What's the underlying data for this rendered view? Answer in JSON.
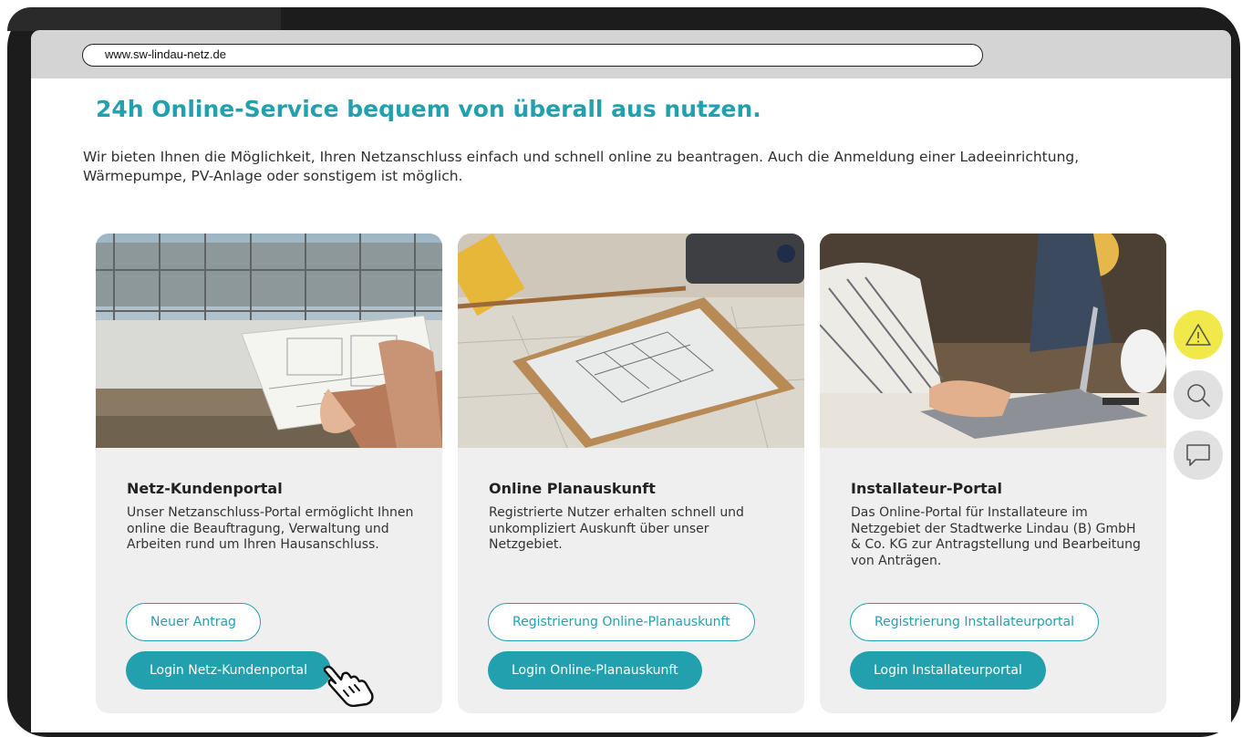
{
  "browser": {
    "url": "www.sw-lindau-netz.de"
  },
  "page": {
    "title": "24h Online-Service bequem von überall aus nutzen.",
    "intro": "Wir bieten Ihnen die Möglichkeit, Ihren Netzanschluss einfach und schnell online zu beantragen. Auch die Anmeldung einer Ladeeinrichtung, Wärmepumpe, PV-Anlage oder sonstigem ist möglich."
  },
  "cards": [
    {
      "title": "Netz-Kundenportal",
      "description": "Unser Netzanschluss-Portal ermöglicht Ihnen online die Beauftragung, Verwaltung und Arbeiten rund um Ihren Hausanschluss.",
      "secondary_button": "Neuer Antrag",
      "primary_button": "Login Netz-Kundenportal"
    },
    {
      "title": "Online Planauskunft",
      "description": "Registrierte Nutzer erhalten schnell und unkompliziert Auskunft über unser Netzgebiet.",
      "secondary_button": "Registrierung Online-Planauskunft",
      "primary_button": "Login Online-Planauskunft"
    },
    {
      "title": "Installateur-Portal",
      "description": "Das Online-Portal für Installateure im Netzgebiet der Stadtwerke Lindau (B) GmbH & Co. KG zur Antragstellung und Bearbeitung von Anträgen.",
      "secondary_button": "Registrierung Installateurportal",
      "primary_button": "Login Installateurportal"
    }
  ],
  "side_actions": [
    {
      "icon": "warning-icon",
      "color": "#f1e94a"
    },
    {
      "icon": "search-icon",
      "color": "#e1e1e1"
    },
    {
      "icon": "chat-icon",
      "color": "#e1e1e1"
    }
  ],
  "colors": {
    "accent": "#23a0ae",
    "card_bg": "#efefef",
    "device_frame": "#1c1c1c"
  }
}
